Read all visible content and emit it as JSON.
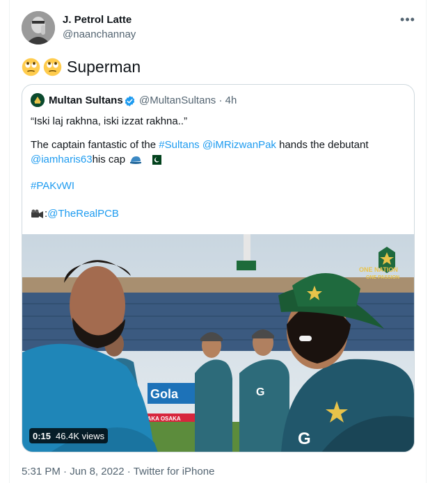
{
  "tweet": {
    "author_name": "J. Petrol Latte",
    "author_handle": "@naanchannay",
    "more_icon": "more-options-icon",
    "text": "Superman",
    "emoji_icons": [
      "face-with-rolling-eyes-emoji",
      "face-with-rolling-eyes-emoji"
    ],
    "time": "5:31 PM",
    "date": "Jun 8, 2022",
    "source": "Twitter for iPhone",
    "separator": "·"
  },
  "quoted": {
    "name": "Multan Sultans",
    "handle": "@MultanSultans",
    "separator": "·",
    "time": "4h",
    "line1": "“Iski laj rakhna, iski izzat rakhna..”",
    "line2_pre": "The captain fantastic of the ",
    "line2_tag": "#Sultans",
    "line2_space": " ",
    "line2_mention": "@iMRizwanPak",
    "line2_post": " hands the debutant",
    "line3_mention": "@iamharis63",
    "line3_post": " his cap",
    "line4_tag": "#PAKvWI",
    "line5_pre": ": ",
    "line5_mention": "@TheRealPCB",
    "video_duration": "0:15",
    "video_views": "46.4K views",
    "overlay_badge_top": "ONE NATION",
    "overlay_badge_bottom": "ONE PASSION",
    "banner_text": "Gola",
    "sponsor_text": "OSAKA  OSAKA"
  },
  "colors": {
    "link": "#1d9bf0",
    "secondary_text": "#536471",
    "verified": "#1d9bf0",
    "jersey_green": "#0f6b5f"
  }
}
